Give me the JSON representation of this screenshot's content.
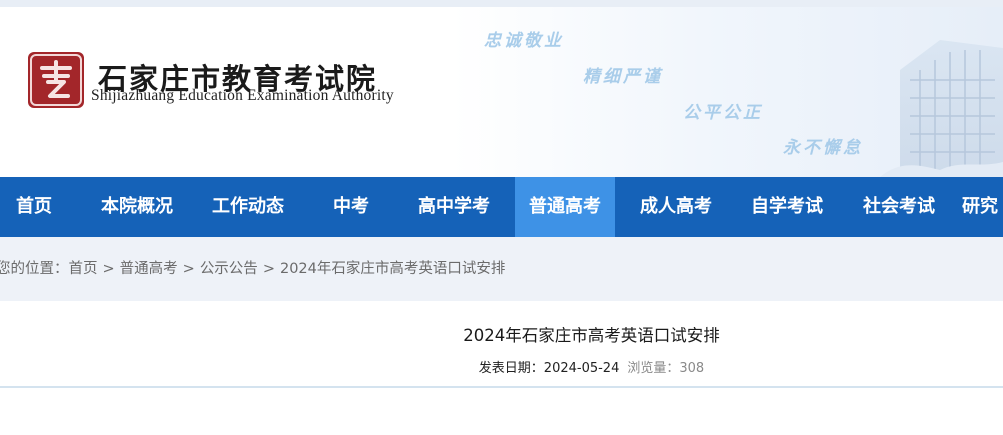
{
  "header": {
    "site_name_cn": "石家庄市教育考试院",
    "site_name_en": "Shijiazhuang Education Examination Authority",
    "slogans": [
      "忠诚敬业",
      "精细严谨",
      "公平公正",
      "永不懈怠"
    ]
  },
  "nav": {
    "items": [
      {
        "label": "首页"
      },
      {
        "label": "本院概况"
      },
      {
        "label": "工作动态"
      },
      {
        "label": "中考"
      },
      {
        "label": "高中学考"
      },
      {
        "label": "普通高考",
        "active": true
      },
      {
        "label": "成人高考"
      },
      {
        "label": "自学考试"
      },
      {
        "label": "社会考试"
      },
      {
        "label": "研究"
      }
    ],
    "bg_color": "#1562b8",
    "active_color": "#3e92e6"
  },
  "breadcrumb": {
    "prefix": "您的位置：",
    "items": [
      "首页",
      "普通高考",
      "公示公告",
      "2024年石家庄市高考英语口试安排"
    ],
    "separator": ">"
  },
  "article": {
    "title": "2024年石家庄市高考英语口试安排",
    "date_label": "发表日期：",
    "date": "2024-05-24",
    "views_label": "浏览量：",
    "views": "308"
  }
}
